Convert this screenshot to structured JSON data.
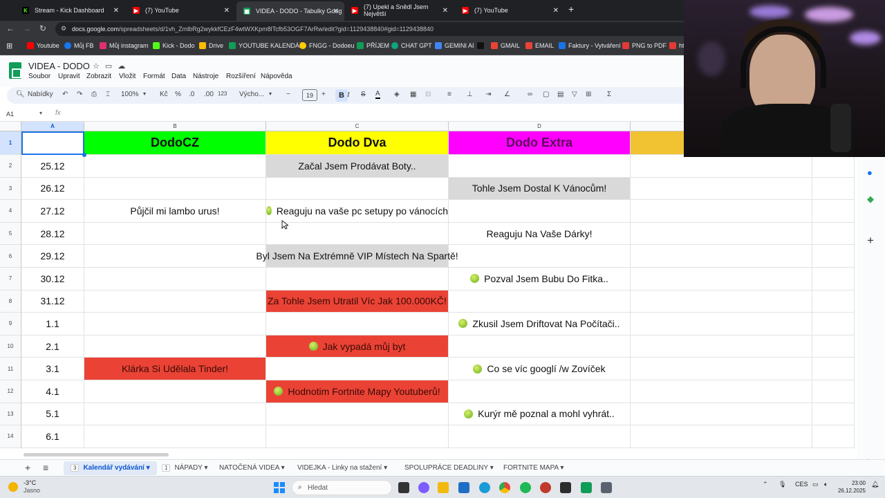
{
  "browser": {
    "tabs": [
      {
        "title": "Stream - Kick Dashboard",
        "icon": "kick-icon",
        "color": "#53fc18"
      },
      {
        "title": "(7) YouTube",
        "icon": "youtube-icon",
        "color": "#ff0000"
      },
      {
        "title": "VIDEA - DODO - Tabulky Goog",
        "icon": "sheets-icon",
        "color": "#0f9d58"
      },
      {
        "title": "(7) Upekl a Snědl Jsem Největší",
        "icon": "youtube-icon",
        "color": "#ff0000"
      },
      {
        "title": "(7) YouTube",
        "icon": "youtube-icon",
        "color": "#ff0000"
      }
    ],
    "url_domain": "docs.google.com",
    "url_path": "/spreadsheets/d/1vh_ZmlbRg2wykkfCEzF4wtWXKpm8lTcfb53OGF7ArRw/edit?gid=1129438840#gid=1129438840",
    "bookmarks": [
      {
        "label": "Youtube",
        "color": "#ff0000"
      },
      {
        "label": "Můj FB",
        "color": "#1877f2"
      },
      {
        "label": "Můj instagram",
        "color": "#e1306c"
      },
      {
        "label": "Kick - Dodo",
        "color": "#53fc18"
      },
      {
        "label": "Drive",
        "color": "#fbbc04"
      },
      {
        "label": "YOUTUBE KALENDÁŘ",
        "color": "#0f9d58"
      },
      {
        "label": "FNGG - Dodoeu",
        "color": "#ffcc00"
      },
      {
        "label": "PŘÍJEM",
        "color": "#0f9d58"
      },
      {
        "label": "CHAT GPT",
        "color": "#10a37f"
      },
      {
        "label": "GEMINI AI",
        "color": "#4285f4"
      },
      {
        "label": "GMAIL",
        "color": "#ea4335"
      },
      {
        "label": "EMAIL",
        "color": "#ea4335"
      },
      {
        "label": "Faktury - Vytváření",
        "color": "#1a73e8"
      },
      {
        "label": "PNG to PDF",
        "color": "#e53935"
      },
      {
        "label": "ht",
        "color": "#e53935"
      }
    ]
  },
  "doc": {
    "title": "VIDEA - DODO",
    "menu": [
      "Soubor",
      "Upravit",
      "Zobrazit",
      "Vložit",
      "Formát",
      "Data",
      "Nástroje",
      "Rozšíření",
      "Nápověda"
    ]
  },
  "toolbar": {
    "search": "Nabídky",
    "zoom": "100%",
    "currency": "Kč",
    "percent": "%",
    "dec_minus": ".0",
    "dec_plus": ".00",
    "format_123": "123",
    "font": "Výcho...",
    "font_size": "19",
    "bold": "B",
    "italic": "I",
    "strike": "S",
    "textcolor": "A",
    "sigma": "Σ"
  },
  "formula_bar": {
    "name_box": "A1",
    "fx": "fx"
  },
  "grid": {
    "columns": [
      "A",
      "B",
      "C",
      "D"
    ],
    "header_row": {
      "b": "DodoCZ",
      "c": "Dodo Dva",
      "d": "Dodo Extra"
    },
    "colors": {
      "green": "#00ff00",
      "yellow": "#ffff00",
      "magenta": "#ff00ff",
      "gold": "#f1c232",
      "gray": "#d9d9d9",
      "red": "#ea4335"
    },
    "rows": [
      {
        "n": "2",
        "a": "25.12",
        "b": "",
        "c": "Začal Jsem Prodávat Boty..",
        "d": ""
      },
      {
        "n": "3",
        "a": "26.12",
        "b": "",
        "c": "",
        "d": "Tohle Jsem Dostal K Vánocům!"
      },
      {
        "n": "4",
        "a": "27.12",
        "b": "Půjčil mi lambo urus!",
        "c": "Reaguju na vaše pc setupy po vánocích",
        "d": ""
      },
      {
        "n": "5",
        "a": "28.12",
        "b": "",
        "c": "",
        "d": "Reaguju Na Vaše Dárky!"
      },
      {
        "n": "6",
        "a": "29.12",
        "b": "",
        "c": "Byl Jsem Na Extrémně VIP Místech Na Spartě!",
        "d": ""
      },
      {
        "n": "7",
        "a": "30.12",
        "b": "",
        "c": "",
        "d": "Pozval Jsem Bubu Do Fitka.."
      },
      {
        "n": "8",
        "a": "31.12",
        "b": "",
        "c": "Za Tohle Jsem Utratil Víc Jak 100.000KČ!",
        "d": ""
      },
      {
        "n": "9",
        "a": "1.1",
        "b": "",
        "c": "",
        "d": "Zkusil Jsem Driftovat Na Počítači.."
      },
      {
        "n": "10",
        "a": "2.1",
        "b": "",
        "c": "Jak vypadá můj byt",
        "d": ""
      },
      {
        "n": "11",
        "a": "3.1",
        "b": "Klárka Si Udělala Tinder!",
        "c": "",
        "d": "Co se víc googlí /w Zovíček"
      },
      {
        "n": "12",
        "a": "4.1",
        "b": "",
        "c": "Hodnotim Fortnite Mapy Youtuberů!",
        "d": ""
      },
      {
        "n": "13",
        "a": "5.1",
        "b": "",
        "c": "",
        "d": "Kurýr mě poznal a mohl vyhrát.."
      },
      {
        "n": "14",
        "a": "6.1",
        "b": "",
        "c": "",
        "d": ""
      }
    ]
  },
  "sheet_tabs": {
    "add": "+",
    "list": "≡",
    "tabs": [
      {
        "badge": "3",
        "label": "Kalendář vydávání"
      },
      {
        "badge": "1",
        "label": "NÁPADY"
      },
      {
        "badge": "",
        "label": "NATOČENÁ VIDEA"
      },
      {
        "badge": "",
        "label": "VIDEJKA - Linky na stažení"
      },
      {
        "badge": "",
        "label": "SPOLUPRÁCE DEADLINY"
      },
      {
        "badge": "",
        "label": "FORTNITE MAPA"
      }
    ]
  },
  "taskbar": {
    "temperature": "-3°C",
    "weather": "Jasno",
    "search": "Hledat",
    "lang": "CES",
    "time": "23:00",
    "date": "26.12.2025"
  }
}
